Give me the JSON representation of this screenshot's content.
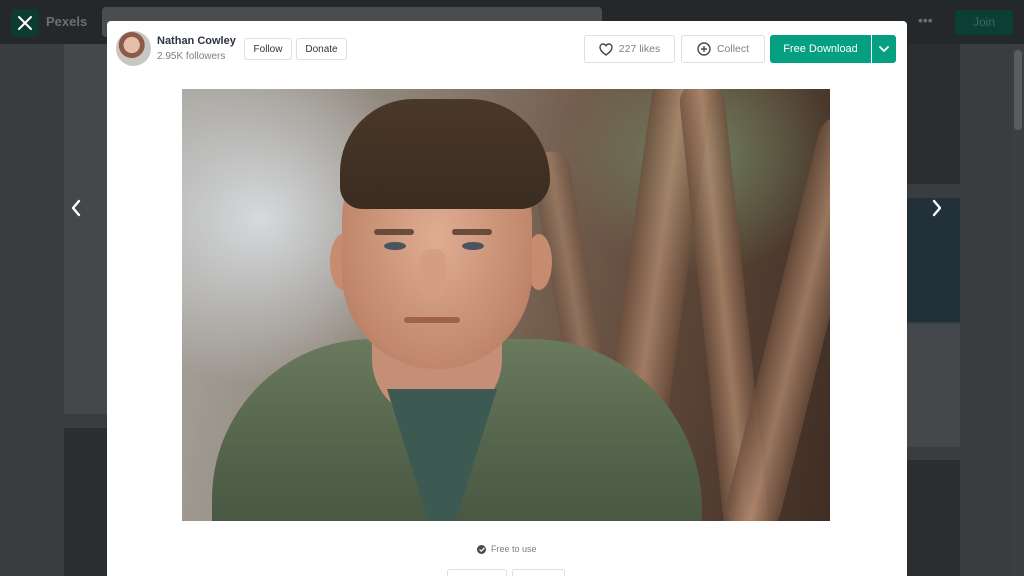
{
  "site": {
    "brand": "Pexels",
    "join_label": "Join",
    "more_icon": "more-dots-icon"
  },
  "modal": {
    "close_icon": "close-icon",
    "author": {
      "name": "Nathan Cowley",
      "followers": "2.95K followers",
      "follow_label": "Follow",
      "donate_label": "Donate"
    },
    "actions": {
      "likes_label": "227 likes",
      "collect_label": "Collect",
      "download_label": "Free Download",
      "accent_color": "#05A081"
    },
    "license_text": "Free to use",
    "nav": {
      "prev_icon": "chevron-left-icon",
      "next_icon": "chevron-right-icon"
    }
  }
}
